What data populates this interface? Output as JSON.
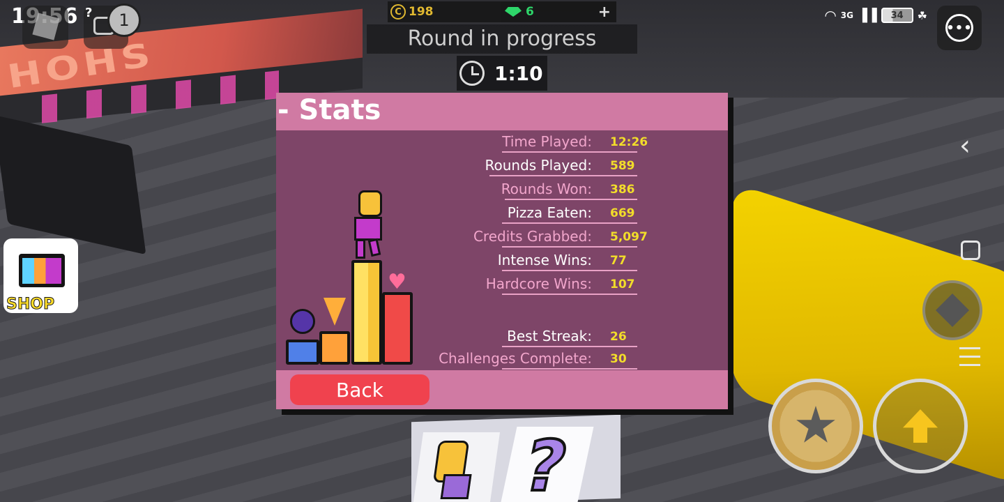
{
  "status_bar": {
    "time": "19:56",
    "network": "3G",
    "signal_unknown": "?",
    "battery": "34"
  },
  "roblox": {
    "notification_count": "1"
  },
  "hud": {
    "coins": "198",
    "gems": "6",
    "round_status": "Round in progress",
    "timer": "1:10"
  },
  "world": {
    "banner_text": "HOHS"
  },
  "stats_panel": {
    "title": "- Stats",
    "back_label": "Back",
    "rows": [
      {
        "label": "Time Played:",
        "value": "12:26",
        "color": "pink"
      },
      {
        "label": "Rounds Played:",
        "value": "589",
        "color": "white"
      },
      {
        "label": "Rounds Won:",
        "value": "386",
        "color": "pink"
      },
      {
        "label": "Pizza Eaten:",
        "value": "669",
        "color": "white"
      },
      {
        "label": "Credits Grabbed:",
        "value": "5,097",
        "color": "pink"
      },
      {
        "label": "Intense Wins:",
        "value": "77",
        "color": "white"
      },
      {
        "label": "Hardcore Wins:",
        "value": "107",
        "color": "pink"
      },
      {
        "label": "Best Streak:",
        "value": "26",
        "color": "white"
      },
      {
        "label": "Challenges Complete:",
        "value": "30",
        "color": "pink"
      }
    ]
  },
  "shop": {
    "label": "SHOP"
  },
  "icons": {
    "roblox_menu": "roblox-logo-icon",
    "chat": "chat-icon",
    "more": "more-options-icon",
    "coin": "coin-icon",
    "gem": "gem-icon",
    "add": "plus-icon",
    "timer": "clock-icon",
    "back_nav": "chevron-left-icon",
    "home_nav": "square-icon",
    "menu_nav": "hamburger-icon",
    "tool": "tool-icon",
    "ability": "star-icon",
    "jump": "jump-arrow-icon"
  },
  "colors": {
    "panel_bg": "#7e4568",
    "panel_header": "#d07aa3",
    "stat_value": "#f2dd2a",
    "back_button": "#f0424e",
    "coins": "#e0b830",
    "gems": "#2ed66a"
  }
}
